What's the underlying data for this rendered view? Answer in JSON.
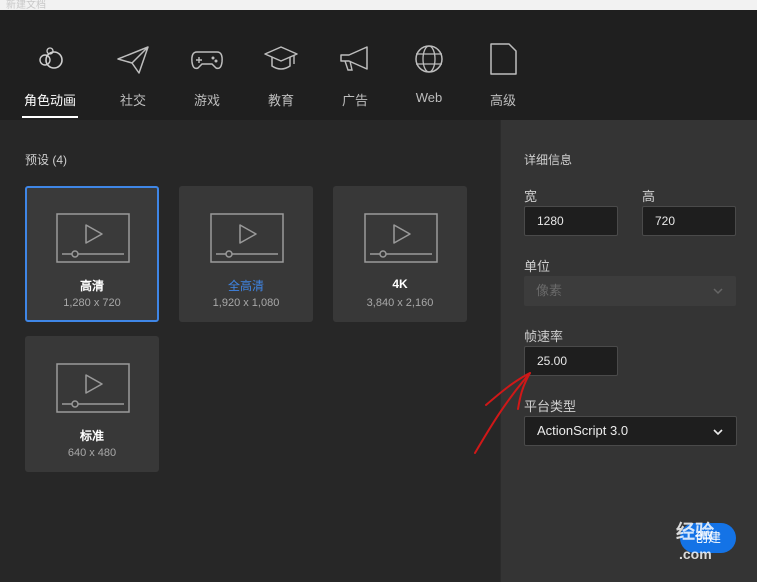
{
  "window": {
    "ghost_title": "新建文档"
  },
  "tabs": [
    {
      "label": "角色动画",
      "icon": "character-animation-icon",
      "active": true
    },
    {
      "label": "社交",
      "icon": "paper-plane-icon"
    },
    {
      "label": "游戏",
      "icon": "gamepad-icon"
    },
    {
      "label": "教育",
      "icon": "graduation-cap-icon"
    },
    {
      "label": "广告",
      "icon": "megaphone-icon"
    },
    {
      "label": "Web",
      "icon": "globe-icon"
    },
    {
      "label": "高级",
      "icon": "document-icon"
    }
  ],
  "presets": {
    "title": "预设 (4)",
    "items": [
      {
        "name": "高清",
        "size": "1,280 x 720",
        "selected": true
      },
      {
        "name": "全高清",
        "size": "1,920 x 1,080",
        "accent": true
      },
      {
        "name": "4K",
        "size": "3,840 x 2,160"
      },
      {
        "name": "标准",
        "size": "640 x 480"
      }
    ]
  },
  "details": {
    "heading": "详细信息",
    "width_label": "宽",
    "width_value": "1280",
    "height_label": "高",
    "height_value": "720",
    "unit_label": "单位",
    "unit_value": "像素",
    "fps_label": "帧速率",
    "fps_value": "25.00",
    "platform_label": "平台类型",
    "platform_value": "ActionScript 3.0"
  },
  "actions": {
    "create_label": "创建"
  },
  "watermark": {
    "line1": "经验",
    "line2": ".com"
  },
  "colors": {
    "accent": "#3f86e6",
    "button": "#1473e6",
    "annotation": "#d01818"
  }
}
